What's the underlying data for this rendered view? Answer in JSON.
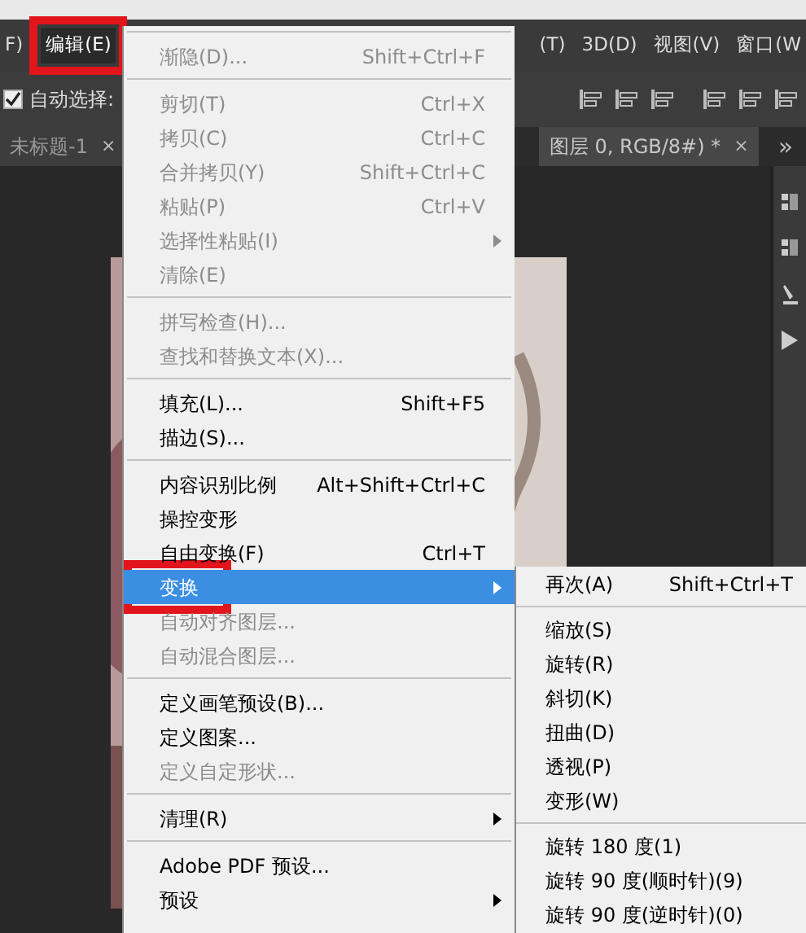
{
  "menu_bar": [
    {
      "label": "F)",
      "selected": false,
      "framed": false
    },
    {
      "label": "编辑(E)",
      "selected": true,
      "framed": true
    },
    {
      "label": "(T)",
      "selected": false,
      "framed": false
    },
    {
      "label": "3D(D)",
      "selected": false,
      "framed": false
    },
    {
      "label": "视图(V)",
      "selected": false,
      "framed": false
    },
    {
      "label": "窗口(W",
      "selected": false,
      "framed": false
    }
  ],
  "toolbar": {
    "auto_select": {
      "label": "自动选择:",
      "checked": true
    }
  },
  "tabs": [
    {
      "label": "未标题-1",
      "close": "×",
      "selected": false
    },
    {
      "label": "图层 0, RGB/8#) *",
      "close": "×",
      "selected": true
    }
  ],
  "tabs_overflow": "»",
  "edit_menu": [
    {
      "kind": "separator"
    },
    {
      "kind": "item",
      "label": "渐隐(D)...",
      "shortcut": "Shift+Ctrl+F",
      "disabled": true,
      "selected": false,
      "submenu": false,
      "framed": false
    },
    {
      "kind": "separator"
    },
    {
      "kind": "item",
      "label": "剪切(T)",
      "shortcut": "Ctrl+X",
      "disabled": true,
      "selected": false,
      "submenu": false,
      "framed": false
    },
    {
      "kind": "item",
      "label": "拷贝(C)",
      "shortcut": "Ctrl+C",
      "disabled": true,
      "selected": false,
      "submenu": false,
      "framed": false
    },
    {
      "kind": "item",
      "label": "合并拷贝(Y)",
      "shortcut": "Shift+Ctrl+C",
      "disabled": true,
      "selected": false,
      "submenu": false,
      "framed": false
    },
    {
      "kind": "item",
      "label": "粘贴(P)",
      "shortcut": "Ctrl+V",
      "disabled": true,
      "selected": false,
      "submenu": false,
      "framed": false
    },
    {
      "kind": "item",
      "label": "选择性粘贴(I)",
      "disabled": true,
      "selected": false,
      "submenu": true,
      "framed": false
    },
    {
      "kind": "item",
      "label": "清除(E)",
      "disabled": true,
      "selected": false,
      "submenu": false,
      "framed": false
    },
    {
      "kind": "separator"
    },
    {
      "kind": "item",
      "label": "拼写检查(H)...",
      "disabled": true,
      "selected": false,
      "submenu": false,
      "framed": false
    },
    {
      "kind": "item",
      "label": "查找和替换文本(X)...",
      "disabled": true,
      "selected": false,
      "submenu": false,
      "framed": false
    },
    {
      "kind": "separator"
    },
    {
      "kind": "item",
      "label": "填充(L)...",
      "shortcut": "Shift+F5",
      "disabled": false,
      "selected": false,
      "submenu": false,
      "framed": false
    },
    {
      "kind": "item",
      "label": "描边(S)...",
      "disabled": false,
      "selected": false,
      "submenu": false,
      "framed": false
    },
    {
      "kind": "separator"
    },
    {
      "kind": "item",
      "label": "内容识别比例",
      "shortcut": "Alt+Shift+Ctrl+C",
      "disabled": false,
      "selected": false,
      "submenu": false,
      "framed": false
    },
    {
      "kind": "item",
      "label": "操控变形",
      "disabled": false,
      "selected": false,
      "submenu": false,
      "framed": false
    },
    {
      "kind": "item",
      "label": "自由变换(F)",
      "shortcut": "Ctrl+T",
      "disabled": false,
      "selected": false,
      "submenu": false,
      "framed": false
    },
    {
      "kind": "item",
      "label": "变换",
      "disabled": false,
      "selected": true,
      "submenu": true,
      "framed": true
    },
    {
      "kind": "item",
      "label": "自动对齐图层...",
      "disabled": true,
      "selected": false,
      "submenu": false,
      "framed": false
    },
    {
      "kind": "item",
      "label": "自动混合图层...",
      "disabled": true,
      "selected": false,
      "submenu": false,
      "framed": false
    },
    {
      "kind": "separator"
    },
    {
      "kind": "item",
      "label": "定义画笔预设(B)...",
      "disabled": false,
      "selected": false,
      "submenu": false,
      "framed": false
    },
    {
      "kind": "item",
      "label": "定义图案...",
      "disabled": false,
      "selected": false,
      "submenu": false,
      "framed": false
    },
    {
      "kind": "item",
      "label": "定义自定形状...",
      "disabled": true,
      "selected": false,
      "submenu": false,
      "framed": false
    },
    {
      "kind": "separator"
    },
    {
      "kind": "item",
      "label": "清理(R)",
      "disabled": false,
      "selected": false,
      "submenu": true,
      "framed": false
    },
    {
      "kind": "separator"
    },
    {
      "kind": "item",
      "label": "Adobe PDF 预设...",
      "disabled": false,
      "selected": false,
      "submenu": false,
      "framed": false
    },
    {
      "kind": "item",
      "label": "预设",
      "disabled": false,
      "selected": false,
      "submenu": true,
      "framed": false
    }
  ],
  "transform_submenu": [
    {
      "kind": "item",
      "label": "再次(A)",
      "shortcut": "Shift+Ctrl+T"
    },
    {
      "kind": "separator"
    },
    {
      "kind": "item",
      "label": "缩放(S)"
    },
    {
      "kind": "item",
      "label": "旋转(R)"
    },
    {
      "kind": "item",
      "label": "斜切(K)"
    },
    {
      "kind": "item",
      "label": "扭曲(D)"
    },
    {
      "kind": "item",
      "label": "透视(P)"
    },
    {
      "kind": "item",
      "label": "变形(W)"
    },
    {
      "kind": "separator"
    },
    {
      "kind": "item",
      "label": "旋转 180 度(1)"
    },
    {
      "kind": "item",
      "label": "旋转 90 度(顺时针)(9)"
    },
    {
      "kind": "item",
      "label": "旋转 90 度(逆时针)(0)"
    }
  ]
}
